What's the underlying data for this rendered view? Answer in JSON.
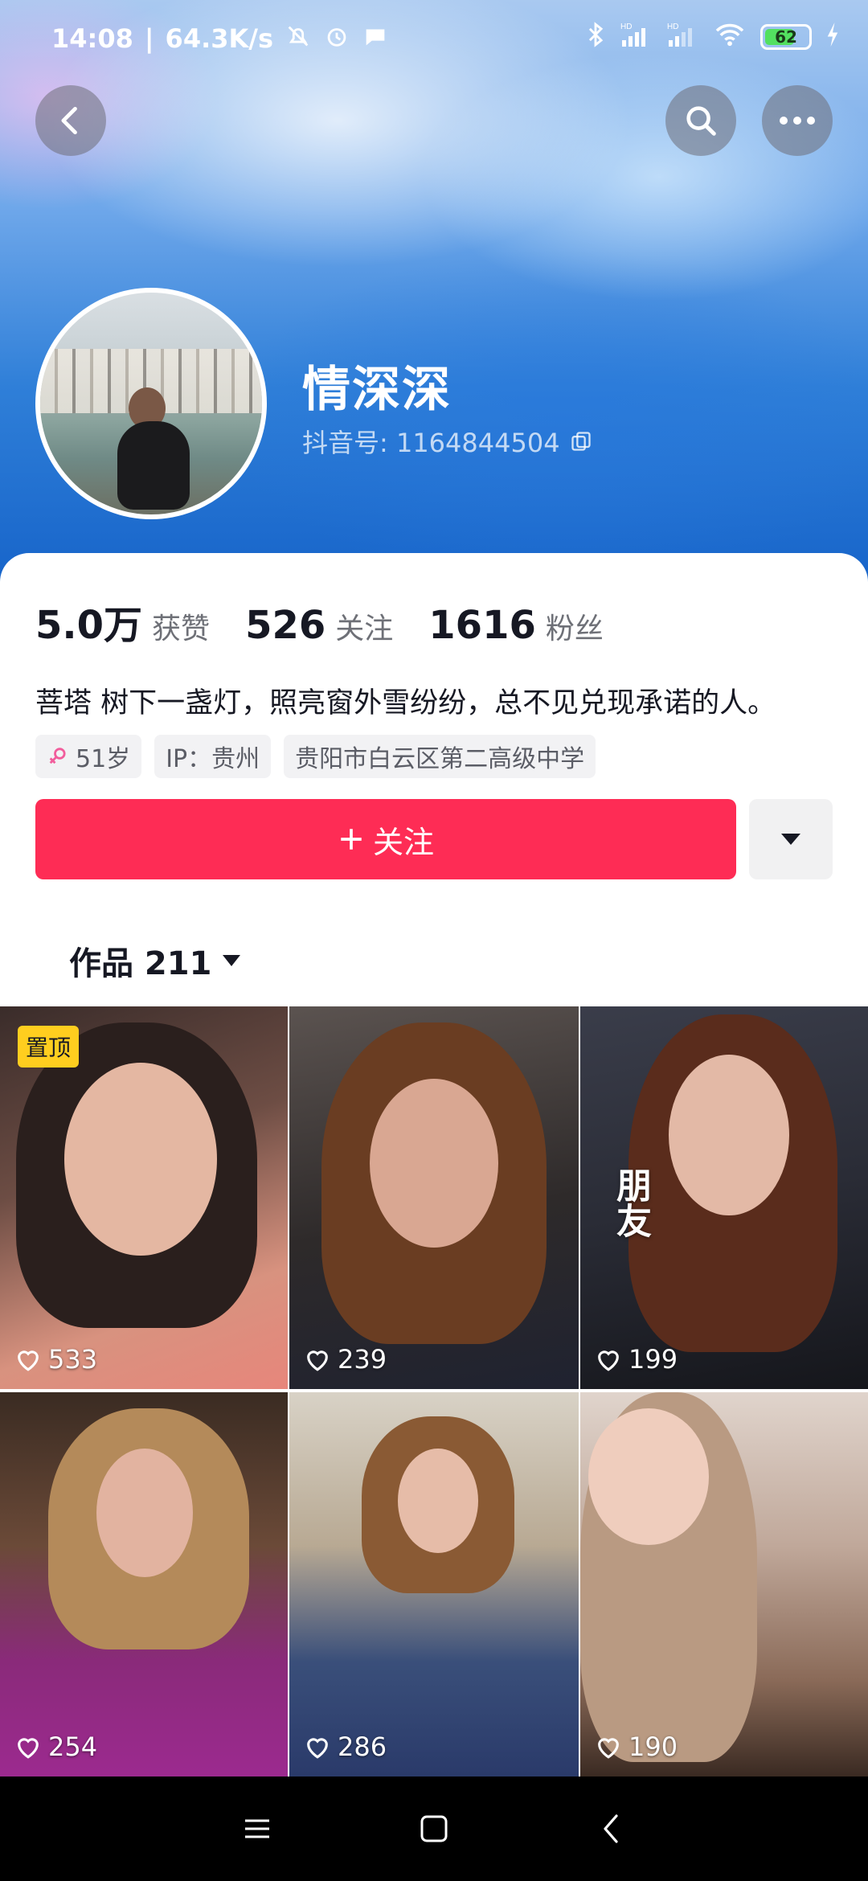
{
  "status_bar": {
    "time": "14:08",
    "network_speed": "64.3K/s",
    "battery": "62",
    "signal_label_1": "HD",
    "signal_label_2": "HD"
  },
  "profile": {
    "name": "情深深",
    "douyin_id": "抖音号: 1164844504"
  },
  "stats": [
    {
      "value": "5.0万",
      "label": "获赞"
    },
    {
      "value": "526",
      "label": "关注"
    },
    {
      "value": "1616",
      "label": "粉丝"
    }
  ],
  "bio": "菩塔 树下一盏灯，照亮窗外雪纷纷，总不见兑现承诺的人。",
  "tags": {
    "age": "51岁",
    "ip": "IP：贵州",
    "school": "贵阳市白云区第二高级中学"
  },
  "actions": {
    "follow_label": "关注"
  },
  "works_tab": {
    "label": "作品 211"
  },
  "videos": [
    {
      "likes": "533",
      "badge": "置顶"
    },
    {
      "likes": "239"
    },
    {
      "likes": "199",
      "overlay_text": "朋友"
    },
    {
      "likes": "254"
    },
    {
      "likes": "286"
    },
    {
      "likes": "190"
    }
  ],
  "colors": {
    "accent": "#fe2c55",
    "pinned_badge": "#ffce1f",
    "header_blue": "#2f7fd8"
  },
  "icons": {
    "back": "back-arrow-icon",
    "search": "search-icon",
    "more": "more-dots-icon",
    "copy": "copy-icon",
    "female": "female-icon",
    "dropdown": "triangle-down-icon",
    "heart": "heart-icon"
  }
}
